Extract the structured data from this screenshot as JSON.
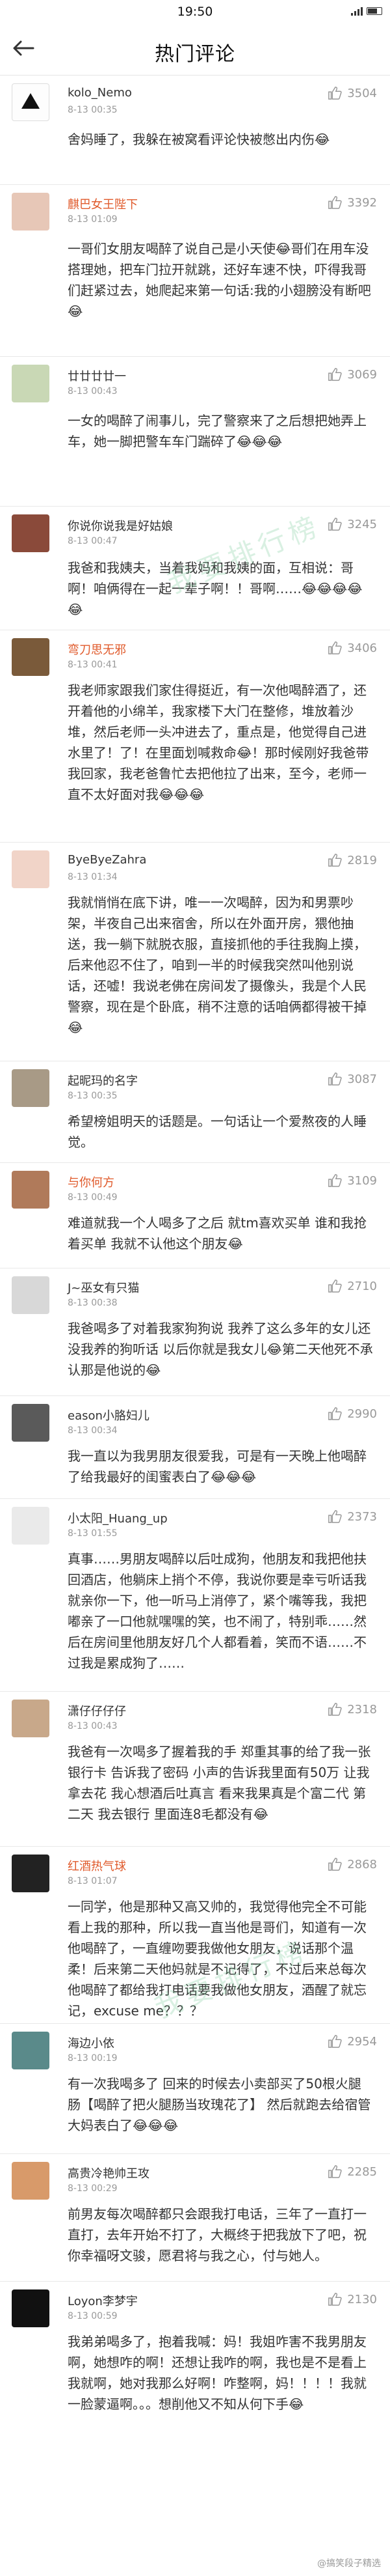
{
  "status_bar": {
    "time": "19:50"
  },
  "header": {
    "title": "热门评论"
  },
  "watermark_text": "我要排行榜",
  "footer_watermark": "@搞笑段子精选",
  "comments": [
    {
      "name": "kolo_Nemo",
      "time": "8-13 00:35",
      "likes": "3504",
      "text": "舍妈睡了，我躲在被窝看评论快被憋出内伤😂"
    },
    {
      "name": "麒巴女王陛下",
      "time": "8-13 01:09",
      "likes": "3392",
      "text": "一哥们女朋友喝醉了说自己是小天使😂哥们在用车没搭理她，把车门拉开就跳，还好车速不快，吓得我哥们赶紧过去，她爬起来第一句话:我的小翅膀没有断吧😂"
    },
    {
      "name": "廿廿廿廿一",
      "time": "8-13 00:43",
      "likes": "3069",
      "text": "一女的喝醉了闹事儿，完了警察来了之后想把她弄上车，她一脚把警车车门踹碎了😂😂😂"
    },
    {
      "name": "你说你说我是好姑娘",
      "time": "8-13 00:47",
      "likes": "3245",
      "text": "我爸和我姨夫，当着我妈和我姨的面，互相说：哥啊！咱俩得在一起一辈子啊！！哥啊……😂😂😂😂😂"
    },
    {
      "name": "弯刀思无邪",
      "time": "8-13 00:41",
      "likes": "3406",
      "text": "我老师家跟我们家住得挺近，有一次他喝醉酒了，还开着他的小绵羊，我家楼下大门在整修，堆放着沙堆，然后老师一头冲进去了，重点是，他觉得自己进水里了！了！在里面划喊救命😂！那时候刚好我爸带我回家，我老爸鲁忙去把他拉了出来，至今，老师一直不太好面对我😂😂😂"
    },
    {
      "name": "ByeByeZahra",
      "time": "8-13 01:34",
      "likes": "2819",
      "text": "我就悄悄在底下讲，唯一一次喝醉，因为和男票吵架，半夜自己出来宿舍，所以在外面开房，猥他抽送，我一躺下就脱衣服，直接抓他的手往我胸上摸，后来他忍不住了，咱到一半的时候我突然叫他别说话，还嘘！我说老佛在房间发了摄像头，我是个人民警察，现在是个卧底，稍不注意的话咱俩都得被干掉😂"
    },
    {
      "name": "起昵玛的名字",
      "time": "8-13 00:35",
      "likes": "3087",
      "text": "希望榜姐明天的话题是。一句话让一个爱熬夜的人睡觉。"
    },
    {
      "name": "与你何方",
      "time": "8-13 00:49",
      "likes": "3109",
      "text": "难道就我一个人喝多了之后 就tm喜欢买单 谁和我抢着买单 我就不认他这个朋友😂"
    },
    {
      "name": "J~巫女有只猫",
      "time": "8-13 00:38",
      "likes": "2710",
      "text": "我爸喝多了对着我家狗狗说  我养了这么多年的女儿还没我养的狗听话 以后你就是我女儿😂第二天他死不承认那是他说的😂"
    },
    {
      "name": "eason小胳妇儿",
      "time": "8-13 00:34",
      "likes": "2990",
      "text": "我一直以为我男朋友很爱我，可是有一天晚上他喝醉了给我最好的闺蜜表白了😂😂😂"
    },
    {
      "name": "小太阳_Huang_up",
      "time": "8-13 01:55",
      "likes": "2373",
      "text": "真事……男朋友喝醉以后吐成狗，他朋友和我把他扶回酒店，他躺床上捎个不停，我说你要是幸亏听话我就亲你一下，他一听马上消停了，紧个嘴等我，我把嘟亲了一口他就嘿嘿的笑，也不闹了，特别乖……然后在房间里他朋友好几个人都看着，笑而不语……不过我是累成狗了……"
    },
    {
      "name": "潇仔仔仔仔",
      "time": "8-13 00:43",
      "likes": "2318",
      "text": "我爸有一次喝多了握着我的手 郑重其事的给了我一张银行卡 告诉我了密码 小声的告诉我里面有50万 让我拿去花 我心想酒后吐真言 看来我果真是个富二代 第二天 我去银行 里面连8毛都没有😂"
    },
    {
      "name": "红酒热气球",
      "time": "8-13 01:07",
      "likes": "2868",
      "text": "一同学，他是那种又高又帅的，我觉得他完全不可能看上我的那种，所以我一直当他是哥们，知道有一次他喝醉了，一直缠吻要我做他女朋友，说话那个温柔！后来第二天他妈就是不记得了，不过后来总每次他喝醉了都给我打电话要我做他女朋友，酒醒了就忘记，excuse me？？？"
    },
    {
      "name": "海边小依",
      "time": "8-13 00:19",
      "likes": "2954",
      "text": "有一次我喝多了  回来的时候去小卖部买了50根火腿肠【喝醉了把火腿肠当玫瑰花了】  然后就跑去给宿管大妈表白了😂😂😂"
    },
    {
      "name": "高贵冷艳帅王攻",
      "time": "8-13 00:29",
      "likes": "2285",
      "text": "前男友每次喝醉都只会跟我打电话，三年了一直打一直打，去年开始不打了，大概终于把我放下了吧，祝你幸福呀文骏，愿君将与我之心，付与她人。"
    },
    {
      "name": "Loyon李梦宇",
      "time": "8-13 00:59",
      "likes": "2130",
      "text": "我弟弟喝多了，抱着我喊：妈！我姐咋害不我男朋友啊，她想咋的啊！还想让我咋的啊，我也是不是看上我就啊，她对我那么好啊！咋整啊，妈！！！！我就一脸蒙逼啊。。。想削他又不知从何下手😂"
    }
  ]
}
